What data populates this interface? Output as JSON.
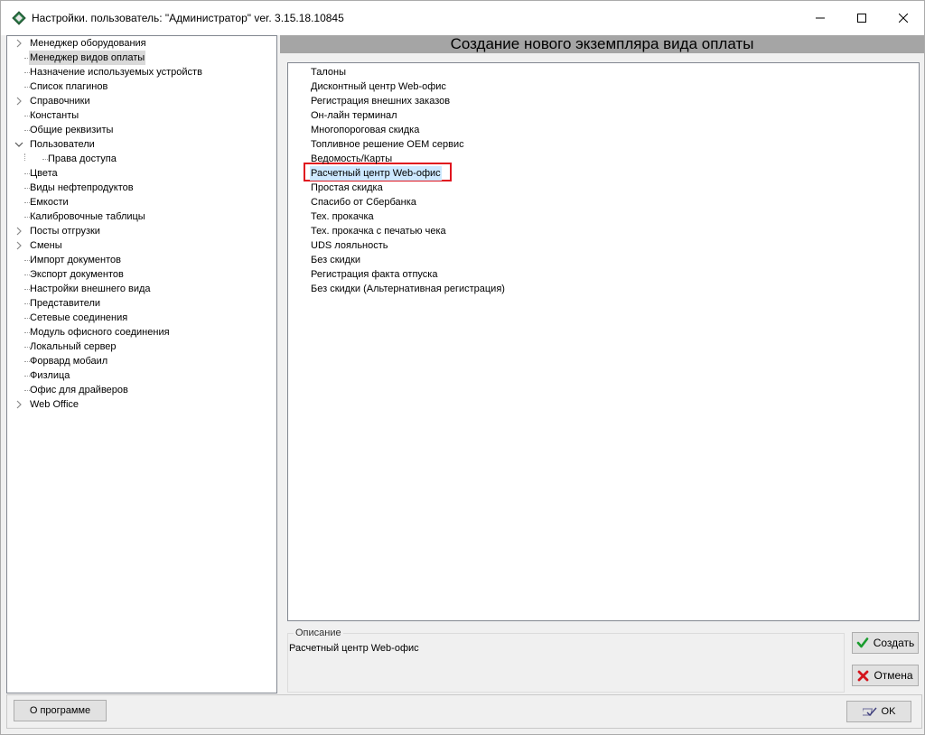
{
  "window": {
    "title": "Настройки. пользователь: \"Администратор\" ver. 3.15.18.10845"
  },
  "tree": {
    "items": [
      {
        "label": "Менеджер оборудования",
        "expander": "chevron-right",
        "level": 0
      },
      {
        "label": "Менеджер видов оплаты",
        "expander": "",
        "level": 0,
        "selected": true
      },
      {
        "label": "Назначение используемых устройств",
        "expander": "",
        "level": 0
      },
      {
        "label": "Список плагинов",
        "expander": "",
        "level": 0
      },
      {
        "label": "Справочники",
        "expander": "chevron-right",
        "level": 0
      },
      {
        "label": "Константы",
        "expander": "",
        "level": 0
      },
      {
        "label": "Общие реквизиты",
        "expander": "",
        "level": 0
      },
      {
        "label": "Пользователи",
        "expander": "chevron-down",
        "level": 0
      },
      {
        "label": "Права доступа",
        "expander": "",
        "level": 1
      },
      {
        "label": "Цвета",
        "expander": "",
        "level": 0
      },
      {
        "label": "Виды нефтепродуктов",
        "expander": "",
        "level": 0
      },
      {
        "label": "Емкости",
        "expander": "",
        "level": 0
      },
      {
        "label": "Калибровочные таблицы",
        "expander": "",
        "level": 0
      },
      {
        "label": "Посты отгрузки",
        "expander": "chevron-right",
        "level": 0
      },
      {
        "label": "Смены",
        "expander": "chevron-right",
        "level": 0
      },
      {
        "label": "Импорт документов",
        "expander": "",
        "level": 0
      },
      {
        "label": "Экспорт документов",
        "expander": "",
        "level": 0
      },
      {
        "label": "Настройки внешнего вида",
        "expander": "",
        "level": 0
      },
      {
        "label": "Представители",
        "expander": "",
        "level": 0
      },
      {
        "label": "Сетевые соединения",
        "expander": "",
        "level": 0
      },
      {
        "label": "Модуль офисного соединения",
        "expander": "",
        "level": 0
      },
      {
        "label": "Локальный сервер",
        "expander": "",
        "level": 0
      },
      {
        "label": "Форвард мобаил",
        "expander": "",
        "level": 0
      },
      {
        "label": "Физлица",
        "expander": "",
        "level": 0
      },
      {
        "label": "Офис для драйверов",
        "expander": "",
        "level": 0
      },
      {
        "label": "Web Office",
        "expander": "chevron-right",
        "level": 0
      }
    ]
  },
  "panel": {
    "header": "Создание нового экземпляра вида оплаты",
    "payment_types": [
      {
        "label": "Талоны"
      },
      {
        "label": "Дисконтный центр Web-офис"
      },
      {
        "label": "Регистрация внешних заказов"
      },
      {
        "label": "Он-лайн терминал"
      },
      {
        "label": "Многопороговая скидка"
      },
      {
        "label": "Топливное решение ОЕМ сервис"
      },
      {
        "label": "Ведомость/Карты"
      },
      {
        "label": "Расчетный центр Web-офис",
        "selected": true
      },
      {
        "label": "Простая скидка"
      },
      {
        "label": "Спасибо от Сбербанка"
      },
      {
        "label": "Тех. прокачка"
      },
      {
        "label": "Тех. прокачка с печатью чека"
      },
      {
        "label": "UDS лояльность"
      },
      {
        "label": "Без скидки"
      },
      {
        "label": "Регистрация факта отпуска"
      },
      {
        "label": "Без скидки (Альтернативная регистрация)"
      }
    ],
    "description": {
      "caption": "Описание",
      "text": "Расчетный центр Web-офис"
    },
    "buttons": {
      "create": "Создать",
      "cancel": "Отмена"
    }
  },
  "footer": {
    "about": "О программе",
    "ok": "OK"
  },
  "icons": {
    "app": "app-logo-icon",
    "create": "green-checkmark-icon",
    "cancel": "red-cross-icon",
    "ok": "checkmark-ok-icon"
  },
  "colors": {
    "header_bg": "#a5a5a5",
    "selection_bg": "#cce8ff",
    "tree_selected_bg": "#d9d9d9",
    "highlight_border": "#e0141e"
  }
}
